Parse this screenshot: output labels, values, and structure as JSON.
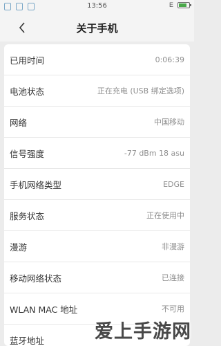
{
  "status_bar": {
    "time": "13:56",
    "signal_text": "E",
    "icons": [
      "notification-icon",
      "sync-icon",
      "box-icon"
    ]
  },
  "header": {
    "title": "关于手机",
    "back_icon": "chevron-left-icon"
  },
  "info_rows": [
    {
      "label": "已用时间",
      "value": "0:06:39"
    },
    {
      "label": "电池状态",
      "value": "正在充电 (USB 绑定选项)"
    },
    {
      "label": "网络",
      "value": "中国移动"
    },
    {
      "label": "信号强度",
      "value": "-77 dBm   18 asu"
    },
    {
      "label": "手机网络类型",
      "value": "EDGE"
    },
    {
      "label": "服务状态",
      "value": "正在使用中"
    },
    {
      "label": "漫游",
      "value": "非漫游"
    },
    {
      "label": "移动网络状态",
      "value": "已连接"
    },
    {
      "label": "WLAN MAC 地址",
      "value": "不可用"
    },
    {
      "label": "蓝牙地址",
      "value": ""
    }
  ],
  "watermark": "爱上手游网",
  "colors": {
    "background": "#ececec",
    "card": "#ffffff",
    "value_text": "#8e8e8e"
  }
}
